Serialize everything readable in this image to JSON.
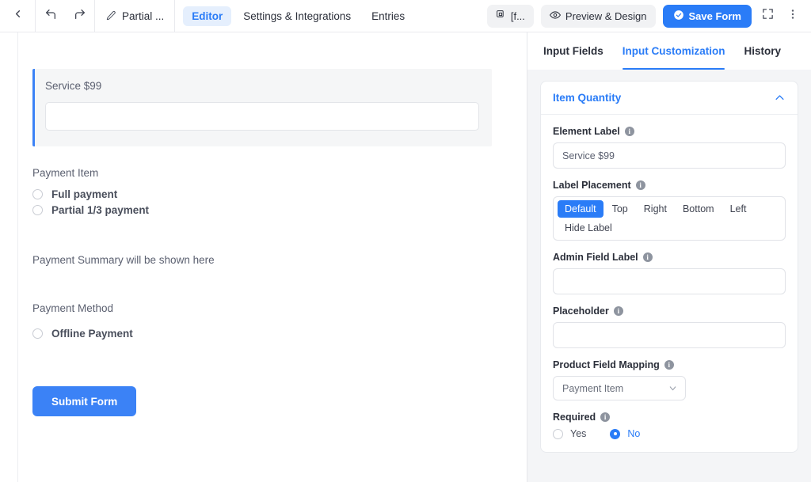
{
  "toolbar": {
    "back_icon": "chevron-left-icon",
    "undo_icon": "undo-arrow-icon",
    "redo_icon": "redo-arrow-icon",
    "edit_icon": "pencil-icon",
    "form_title": "Partial ...",
    "tabs": [
      {
        "label": "Editor",
        "active": true
      },
      {
        "label": "Settings & Integrations",
        "active": false
      },
      {
        "label": "Entries",
        "active": false
      }
    ],
    "shortcode_icon": "copy-icon",
    "shortcode_label": "[f...",
    "preview_icon": "eye-icon",
    "preview_label": "Preview & Design",
    "save_icon": "check-circle-icon",
    "save_label": "Save Form",
    "fullscreen_icon": "fullscreen-corners-icon",
    "more_icon": "kebab-menu-icon"
  },
  "canvas": {
    "selected_field": {
      "label": "Service $99",
      "input_value": ""
    },
    "payment_item": {
      "title": "Payment Item",
      "options": [
        {
          "label": "Full payment",
          "selected": false
        },
        {
          "label": "Partial 1/3 payment",
          "selected": false
        }
      ]
    },
    "summary_text": "Payment Summary will be shown here",
    "payment_method": {
      "title": "Payment Method",
      "options": [
        {
          "label": "Offline Payment",
          "selected": false
        }
      ]
    },
    "submit_label": "Submit Form"
  },
  "panel": {
    "tabs": [
      {
        "label": "Input Fields",
        "active": false
      },
      {
        "label": "Input Customization",
        "active": true
      },
      {
        "label": "History",
        "active": false
      }
    ],
    "card": {
      "title": "Item Quantity",
      "collapse_icon": "chevron-up-icon",
      "element_label": {
        "label": "Element Label",
        "info_icon": "info-icon",
        "value": "Service $99"
      },
      "label_placement": {
        "label": "Label Placement",
        "info_icon": "info-icon",
        "options": [
          {
            "label": "Default",
            "active": true
          },
          {
            "label": "Top",
            "active": false
          },
          {
            "label": "Right",
            "active": false
          },
          {
            "label": "Bottom",
            "active": false
          },
          {
            "label": "Left",
            "active": false
          },
          {
            "label": "Hide Label",
            "active": false
          }
        ]
      },
      "admin_field_label": {
        "label": "Admin Field Label",
        "info_icon": "info-icon",
        "value": ""
      },
      "placeholder": {
        "label": "Placeholder",
        "info_icon": "info-icon",
        "value": ""
      },
      "product_field_mapping": {
        "label": "Product Field Mapping",
        "info_icon": "info-icon",
        "selected": "Payment Item",
        "chevron_icon": "chevron-down-icon"
      },
      "required": {
        "label": "Required",
        "info_icon": "info-icon",
        "options": [
          {
            "label": "Yes",
            "selected": false
          },
          {
            "label": "No",
            "selected": true
          }
        ]
      }
    }
  },
  "colors": {
    "accent": "#2a7cf7",
    "submit": "#3b82f6",
    "panel_bg": "#f4f5f7"
  }
}
